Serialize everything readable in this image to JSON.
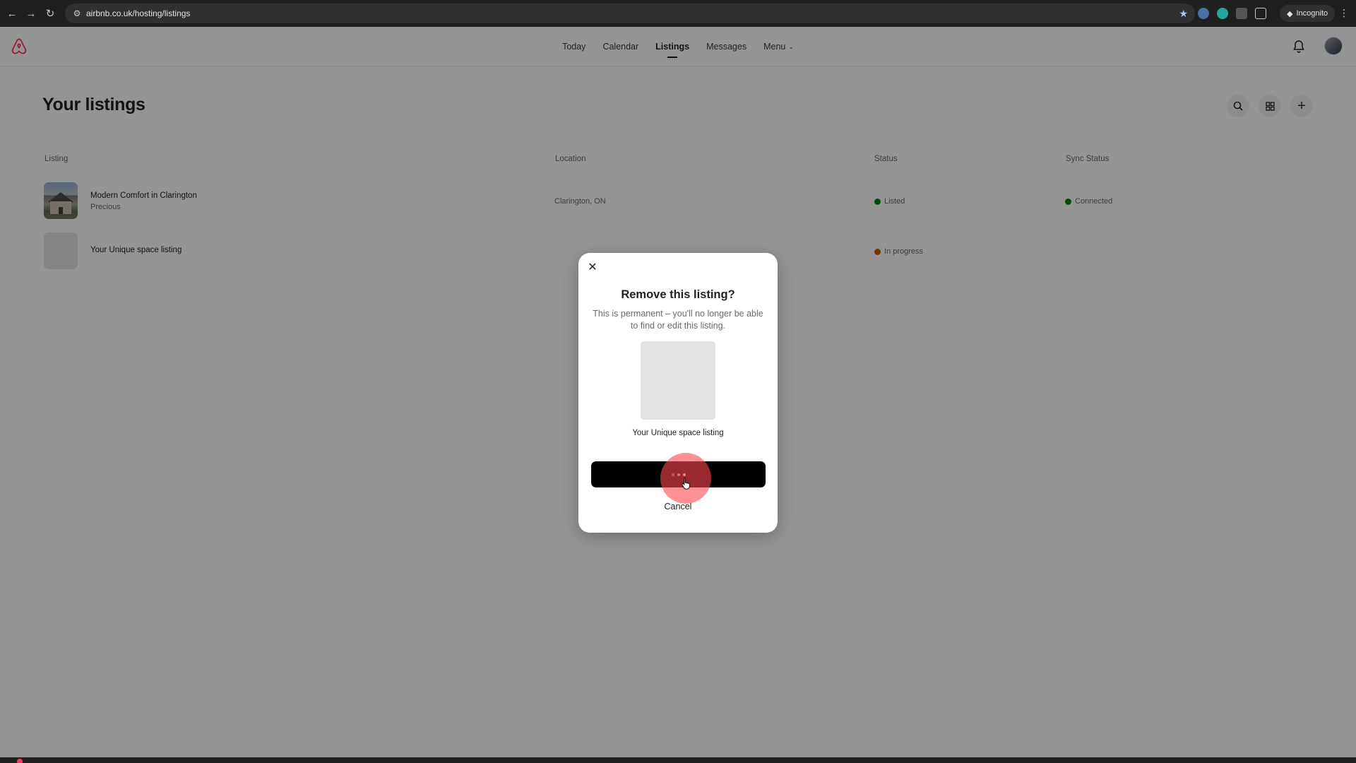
{
  "browser": {
    "url": "airbnb.co.uk/hosting/listings",
    "incognito_label": "Incognito"
  },
  "nav": {
    "items": [
      {
        "label": "Today"
      },
      {
        "label": "Calendar"
      },
      {
        "label": "Listings",
        "active": true
      },
      {
        "label": "Messages"
      },
      {
        "label": "Menu"
      }
    ]
  },
  "page": {
    "title": "Your listings"
  },
  "table": {
    "headers": {
      "listing": "Listing",
      "location": "Location",
      "status": "Status",
      "sync": "Sync Status"
    },
    "rows": [
      {
        "title": "Modern Comfort in Clarington",
        "subtitle": "Precious",
        "location": "Clarington, ON",
        "status": "Listed",
        "status_color": "#008a05",
        "sync": "Connected",
        "sync_color": "#008a05"
      },
      {
        "title": "Your Unique space listing",
        "status": "In progress",
        "status_color": "#c45e00"
      }
    ]
  },
  "modal": {
    "title": "Remove this listing?",
    "text": "This is permanent – you'll no longer be able to find or edit this listing.",
    "listing_name": "Your Unique space listing",
    "cancel_label": "Cancel"
  },
  "icons": {
    "logo": "airbnb-logo",
    "search": "search-icon",
    "grid": "grid-view-icon",
    "add": "add-icon",
    "bell": "bell-icon",
    "close": "close-icon"
  },
  "colors": {
    "brand": "#ff385c",
    "listed": "#008a05",
    "in_progress": "#c45e00"
  }
}
